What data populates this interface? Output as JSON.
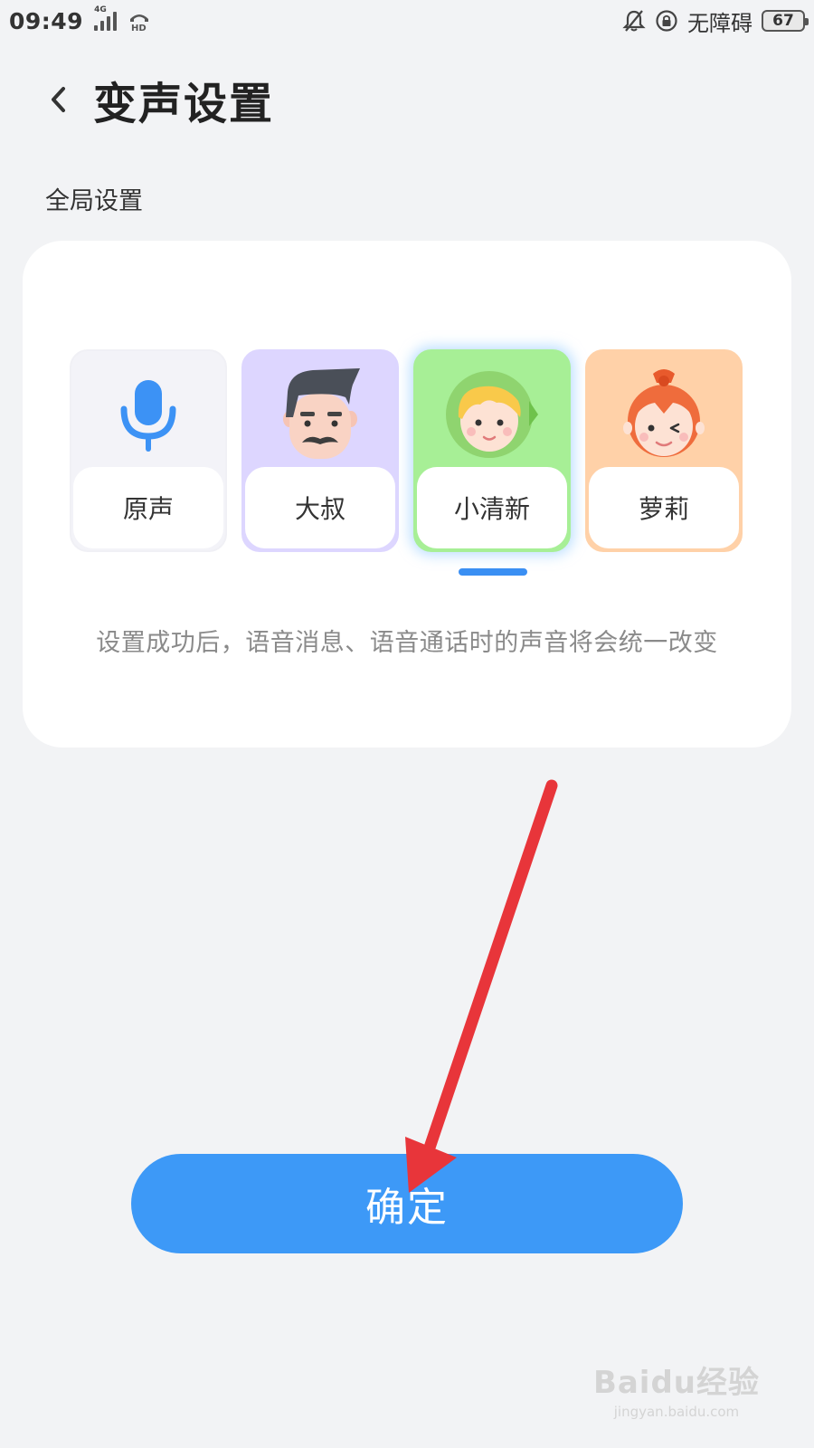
{
  "status_bar": {
    "time": "09:49",
    "network": "4G",
    "accessibility_text": "无障碍",
    "battery": "67"
  },
  "header": {
    "title": "变声设置"
  },
  "section_label": "全局设置",
  "voices": [
    {
      "label": "原声",
      "icon": "microphone-icon"
    },
    {
      "label": "大叔",
      "icon": "uncle-avatar-icon"
    },
    {
      "label": "小清新",
      "icon": "fresh-avatar-icon"
    },
    {
      "label": "萝莉",
      "icon": "loli-avatar-icon"
    }
  ],
  "selected_voice": "小清新",
  "hint": "设置成功后，语音消息、语音通话时的声音将会统一改变",
  "confirm_label": "确定",
  "watermark": {
    "main": "Baidu经验",
    "sub": "jingyan.baidu.com"
  },
  "colors": {
    "accent": "#3d99f7",
    "background": "#f2f3f5",
    "annotation_arrow": "#e8353a"
  }
}
